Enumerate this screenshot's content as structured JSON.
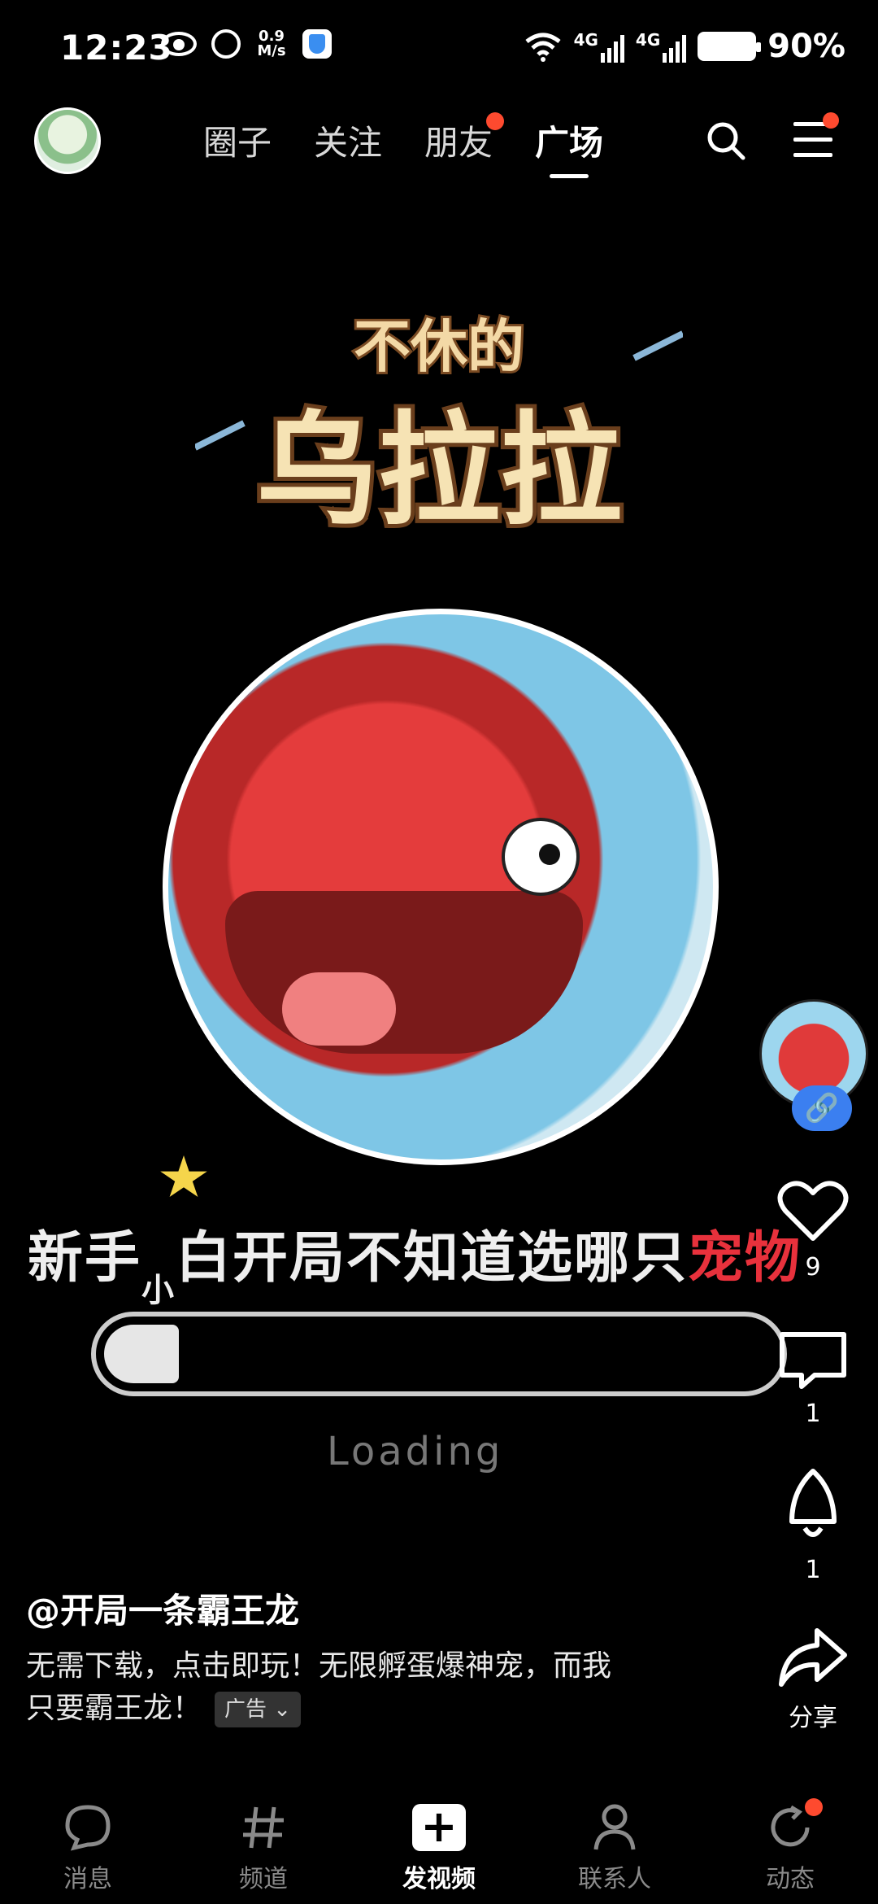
{
  "status_bar": {
    "time": "12:23",
    "speed": "0.9\nM/s",
    "net1": "4G",
    "net2": "4G",
    "battery": "90%"
  },
  "top_nav": {
    "tabs": [
      {
        "label": "圈子"
      },
      {
        "label": "关注"
      },
      {
        "label": "朋友",
        "has_dot": true
      },
      {
        "label": "广场",
        "active": true
      }
    ]
  },
  "video": {
    "game_title_top": "不休的",
    "game_title_main": "乌拉拉",
    "caption_part1": "新手",
    "caption_small": "小",
    "caption_part2": "白开局不知道选哪只",
    "caption_red": "宠物",
    "loading_text": "Loading",
    "loading_progress": 0.08
  },
  "rail": {
    "link_icon": "🔗",
    "like_count": "9",
    "comment_count": "1",
    "rocket_count": "1",
    "share_label": "分享"
  },
  "post": {
    "author": "@开局一条霸王龙",
    "desc_line1": "无需下载，点击即玩！无限孵蛋爆神宠，而我",
    "desc_line2": "只要霸王龙！",
    "ad_label": "广告",
    "ad_chevron": "⌄"
  },
  "bottom_nav": {
    "items": [
      {
        "label": "消息",
        "icon": "chat-bubble-icon"
      },
      {
        "label": "频道",
        "icon": "hash-icon"
      },
      {
        "label": "发视频",
        "icon": "plus-icon",
        "active": true
      },
      {
        "label": "联系人",
        "icon": "person-icon"
      },
      {
        "label": "动态",
        "icon": "refresh-icon",
        "has_dot": true
      }
    ]
  },
  "colors": {
    "accent_dot": "#fe4a2f",
    "link_badge": "#3b7ff0",
    "caption_red": "#e8313c"
  }
}
